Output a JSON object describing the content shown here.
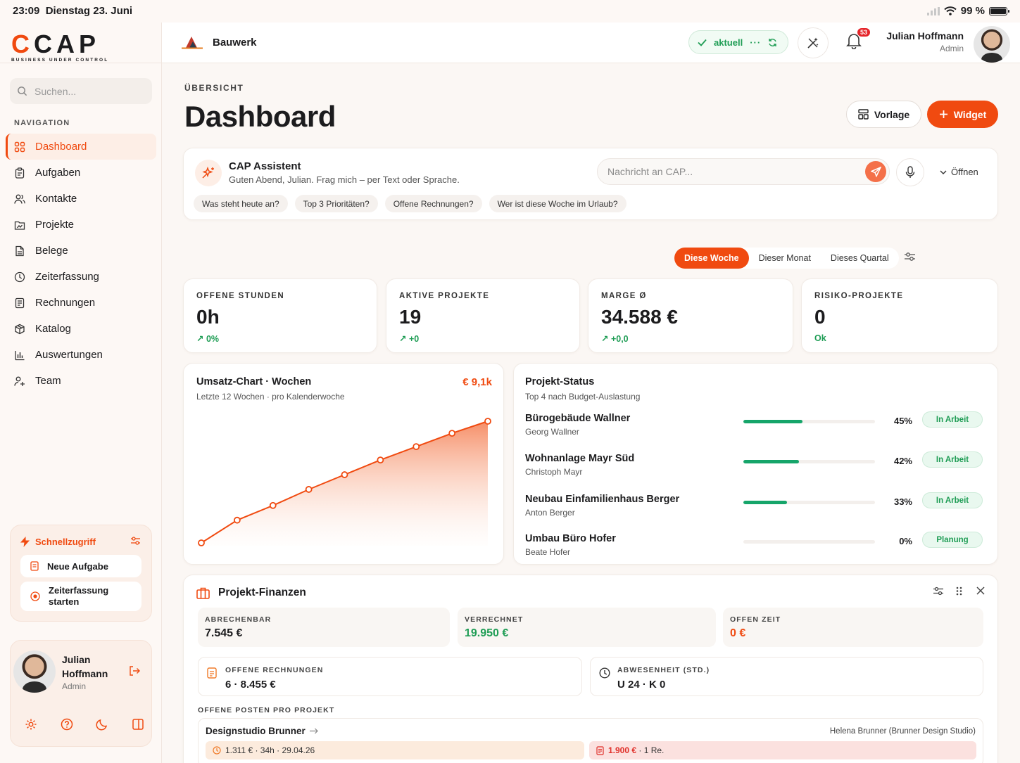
{
  "status_bar": {
    "time": "23:09",
    "date": "Dienstag 23. Juni",
    "battery": "99 %"
  },
  "brand": {
    "name": "CAP",
    "tagline": "BUSINESS UNDER CONTROL"
  },
  "sidebar": {
    "search_placeholder": "Suchen...",
    "nav_title": "NAVIGATION",
    "items": [
      {
        "label": "Dashboard",
        "icon": "grid-icon",
        "active": true
      },
      {
        "label": "Aufgaben",
        "icon": "clipboard-icon"
      },
      {
        "label": "Kontakte",
        "icon": "users-icon"
      },
      {
        "label": "Projekte",
        "icon": "folder-chart-icon"
      },
      {
        "label": "Belege",
        "icon": "document-icon"
      },
      {
        "label": "Zeiterfassung",
        "icon": "clock-icon"
      },
      {
        "label": "Rechnungen",
        "icon": "invoice-icon"
      },
      {
        "label": "Katalog",
        "icon": "box-icon"
      },
      {
        "label": "Auswertungen",
        "icon": "bar-chart-icon"
      },
      {
        "label": "Team",
        "icon": "team-icon"
      }
    ],
    "quick": {
      "title": "Schnellzugriff",
      "items": [
        {
          "label": "Neue Aufgabe",
          "icon": "task-icon"
        },
        {
          "label": "Zeiterfassung starten",
          "icon": "record-icon"
        }
      ]
    },
    "user": {
      "name": "Julian Hoffmann",
      "role": "Admin"
    }
  },
  "topbar": {
    "project": "Bauwerk",
    "sync_label": "aktuell",
    "notification_count": "53",
    "user_name": "Julian Hoffmann",
    "user_role": "Admin"
  },
  "page": {
    "kicker": "ÜBERSICHT",
    "title": "Dashboard",
    "btn_template": "Vorlage",
    "btn_widget": "Widget"
  },
  "assistant": {
    "title": "CAP Assistent",
    "subtitle": "Guten Abend, Julian. Frag mich – per Text oder Sprache.",
    "placeholder": "Nachricht an CAP...",
    "open_label": "Öffnen",
    "chips": [
      "Was steht heute an?",
      "Top 3 Prioritäten?",
      "Offene Rechnungen?",
      "Wer ist diese Woche im Urlaub?"
    ]
  },
  "period": {
    "options": [
      "Diese Woche",
      "Dieser Monat",
      "Dieses Quartal"
    ],
    "active": 0
  },
  "kpis": [
    {
      "label": "OFFENE STUNDEN",
      "value": "0h",
      "delta": "↗ 0%"
    },
    {
      "label": "AKTIVE PROJEKTE",
      "value": "19",
      "delta": "↗ +0"
    },
    {
      "label": "MARGE Ø",
      "value": "34.588 €",
      "delta": "↗ +0,0"
    },
    {
      "label": "RISIKO-PROJEKTE",
      "value": "0",
      "delta": "Ok"
    }
  ],
  "revenue_chart": {
    "title": "Umsatz-Chart · Wochen",
    "subtitle": "Letzte 12 Wochen · pro Kalenderwoche",
    "total": "€ 9,1k"
  },
  "chart_data": {
    "type": "area",
    "title": "Umsatz-Chart · Wochen",
    "subtitle": "Letzte 12 Wochen · pro Kalenderwoche",
    "x": [
      1,
      2,
      3,
      4,
      5,
      6,
      7,
      8,
      9
    ],
    "values": [
      0,
      1.7,
      2.8,
      4.0,
      5.1,
      6.2,
      7.2,
      8.2,
      9.1
    ],
    "ylim": [
      0,
      9.1
    ],
    "grid": false,
    "color": "#f04a10"
  },
  "project_status": {
    "title": "Projekt-Status",
    "subtitle": "Top 4 nach Budget-Auslastung",
    "rows": [
      {
        "name": "Bürogebäude Wallner",
        "manager": "Georg Wallner",
        "percent": 45,
        "percent_label": "45%",
        "status": "In Arbeit"
      },
      {
        "name": "Wohnanlage Mayr Süd",
        "manager": "Christoph Mayr",
        "percent": 42,
        "percent_label": "42%",
        "status": "In Arbeit"
      },
      {
        "name": "Neubau Einfamilienhaus Berger",
        "manager": "Anton Berger",
        "percent": 33,
        "percent_label": "33%",
        "status": "In Arbeit"
      },
      {
        "name": "Umbau Büro Hofer",
        "manager": "Beate Hofer",
        "percent": 0,
        "percent_label": "0%",
        "status": "Planung"
      }
    ]
  },
  "finances": {
    "title": "Projekt-Finanzen",
    "tiles": [
      {
        "label": "ABRECHENBAR",
        "value": "7.545 €",
        "color": "#1c1c1e"
      },
      {
        "label": "VERRECHNET",
        "value": "19.950 €",
        "color": "#1f9d55"
      },
      {
        "label": "OFFEN ZEIT",
        "value": "0 €",
        "color": "#f04a10"
      }
    ],
    "boxes": [
      {
        "label": "OFFENE RECHNUNGEN",
        "value": "6 · 8.455 €"
      },
      {
        "label": "ABWESENHEIT (STD.)",
        "value": "U 24 · K 0"
      }
    ],
    "open_items_title": "OFFENE POSTEN PRO PROJEKT",
    "open_items": [
      {
        "project": "Designstudio Brunner",
        "client": "Helena Brunner (Brunner Design Studio)",
        "hours": "1.311 € · 34h · 29.04.26",
        "invoice_amount": "1.900 €",
        "invoice_count": " · 1 Re."
      }
    ]
  }
}
